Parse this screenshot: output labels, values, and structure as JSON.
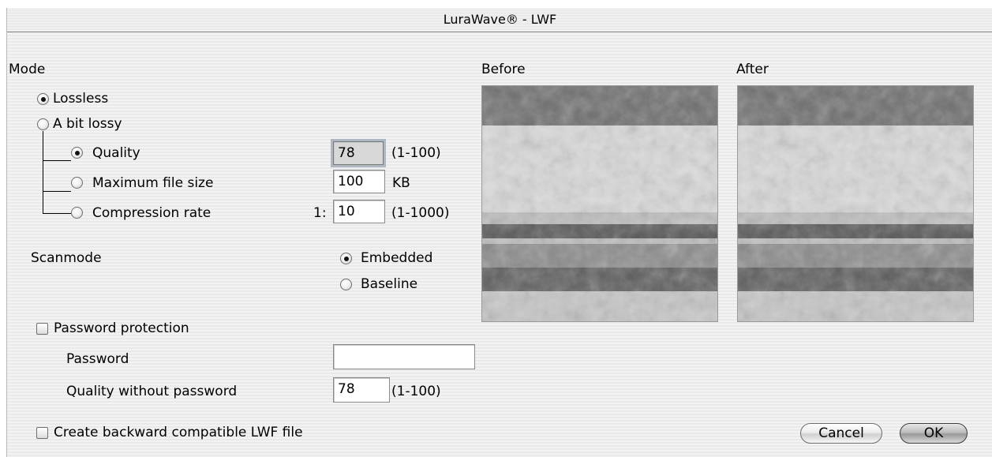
{
  "window": {
    "title": "LuraWave® - LWF"
  },
  "mode": {
    "heading": "Mode",
    "lossless_label": "Lossless",
    "lossy_label": "A bit lossy",
    "quality_label": "Quality",
    "quality_value": "78",
    "quality_range": "(1-100)",
    "max_size_label": "Maximum file size",
    "max_size_value": "100",
    "max_size_unit": "KB",
    "compression_label": "Compression rate",
    "compression_prefix": "1:",
    "compression_value": "10",
    "compression_range": "(1-1000)"
  },
  "scanmode": {
    "heading": "Scanmode",
    "embedded_label": "Embedded",
    "baseline_label": "Baseline"
  },
  "password": {
    "protection_label": "Password protection",
    "password_label": "Password",
    "password_value": "",
    "quality_without_label": "Quality without password",
    "quality_without_value": "78",
    "quality_without_range": "(1-100)"
  },
  "compat": {
    "label": "Create backward compatible LWF file"
  },
  "preview": {
    "before_label": "Before",
    "after_label": "After"
  },
  "buttons": {
    "cancel": "Cancel",
    "ok": "OK"
  }
}
